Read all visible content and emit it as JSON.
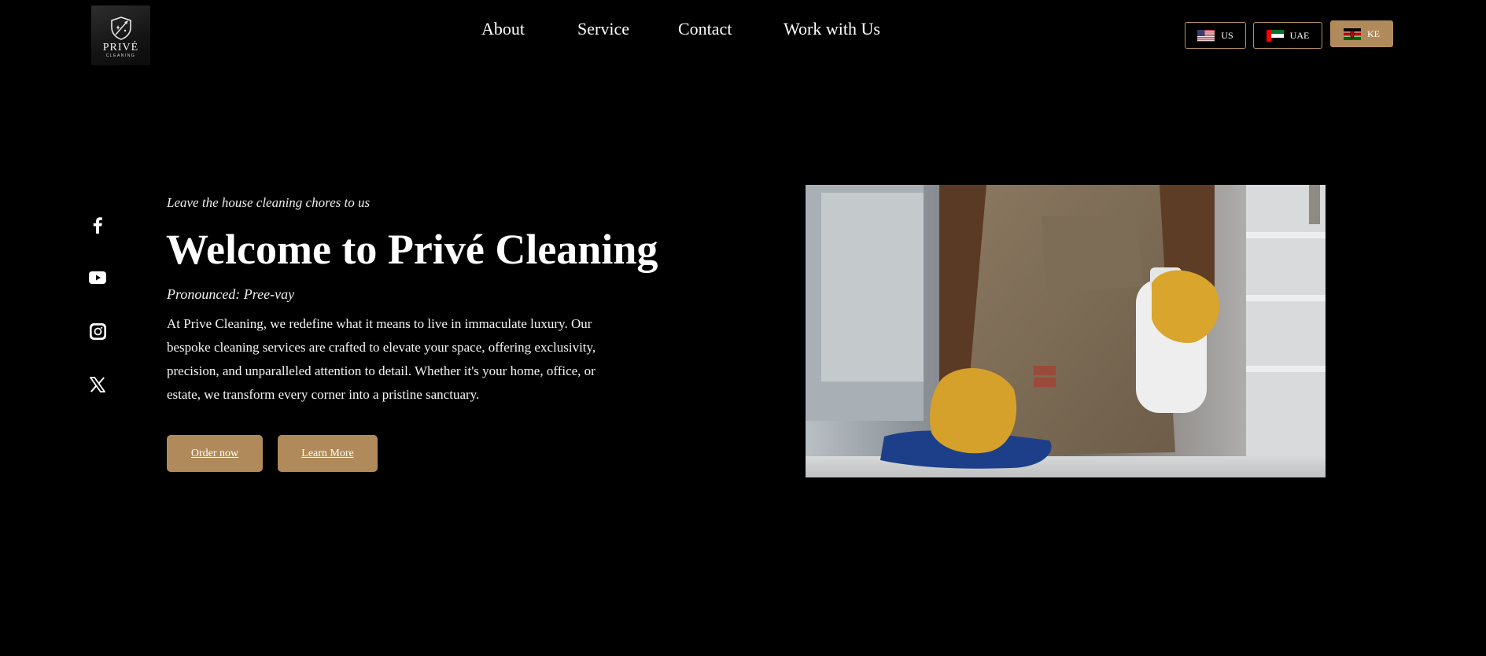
{
  "brand": {
    "logo_name": "PRIVÉ",
    "logo_subtitle": "CLEANING"
  },
  "nav": {
    "items": [
      {
        "label": "About"
      },
      {
        "label": "Service"
      },
      {
        "label": "Contact"
      },
      {
        "label": "Work with Us"
      }
    ]
  },
  "regions": [
    {
      "code": "US",
      "flag": "us-flag-icon",
      "active": false
    },
    {
      "code": "UAE",
      "flag": "uae-flag-icon",
      "active": false
    },
    {
      "code": "KE",
      "flag": "kenya-flag-icon",
      "active": true
    }
  ],
  "social": [
    "facebook-icon",
    "youtube-icon",
    "instagram-icon",
    "x-icon"
  ],
  "hero": {
    "tagline": "Leave the house cleaning chores to us",
    "title": "Welcome to Privé Cleaning",
    "pronounced": "Pronounced: Pree-vay",
    "body": "At Prive Cleaning, we redefine what it means to live in immaculate luxury. Our bespoke cleaning services are crafted to elevate your space, offering exclusivity, precision, and unparalleled attention to detail. Whether it's your home, office, or estate, we transform every corner into a pristine sanctuary.",
    "buttons": {
      "order": "Order now",
      "learn": "Learn More"
    }
  },
  "colors": {
    "background": "#000000",
    "accent": "#b08a5a",
    "text": "#ffffff"
  }
}
